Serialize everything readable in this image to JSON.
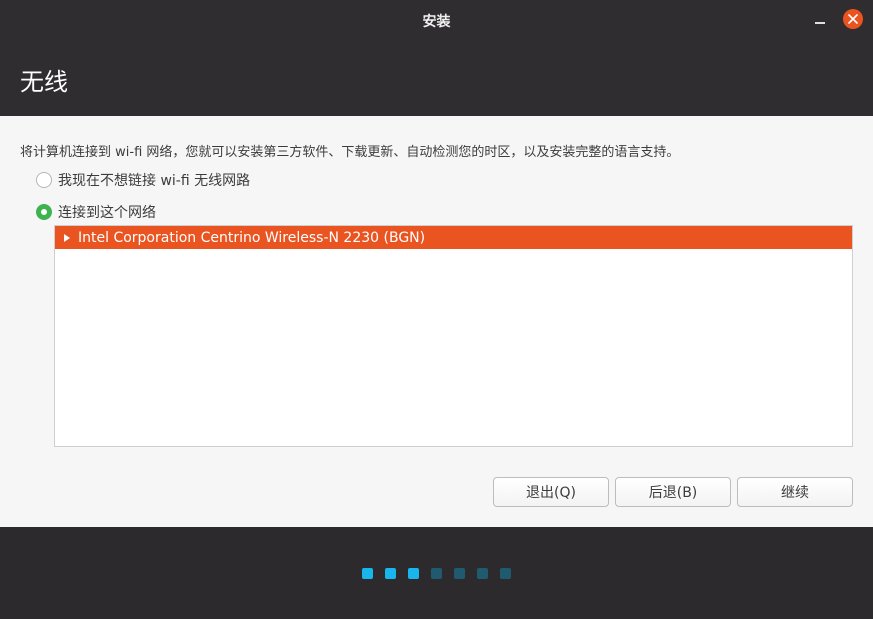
{
  "window": {
    "title": "安装",
    "close_icon": "close-icon",
    "minimize_icon": "minimize-icon"
  },
  "header": {
    "title": "无线"
  },
  "content": {
    "description": "将计算机连接到 wi-fi 网络，您就可以安装第三方软件、下载更新、自动检测您的时区，以及安装完整的语言支持。",
    "options": [
      {
        "label": "我现在不想链接 wi-fi 无线网路",
        "checked": false
      },
      {
        "label": "连接到这个网络",
        "checked": true
      }
    ],
    "networks": [
      {
        "label": "Intel Corporation Centrino Wireless-N 2230 (BGN)",
        "selected": true,
        "icon": "expander-arrow-icon"
      }
    ]
  },
  "buttons": {
    "quit": "退出(Q)",
    "back": "后退(B)",
    "continue": "继续"
  },
  "progress": {
    "total_steps": 7,
    "completed_steps": 3,
    "colors": {
      "done": "#19b6ee",
      "pending": "#1f5a6e",
      "accent": "#e95420",
      "check": "#3eb34f"
    }
  }
}
